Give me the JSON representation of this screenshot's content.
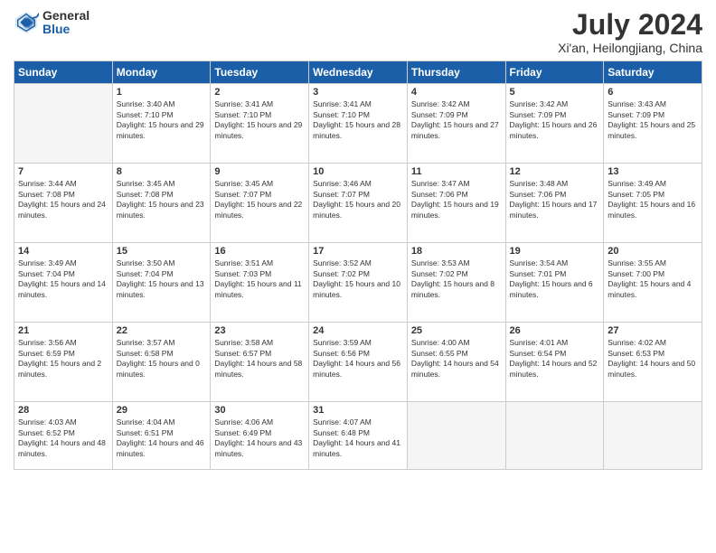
{
  "header": {
    "logo_general": "General",
    "logo_blue": "Blue",
    "month_year": "July 2024",
    "location": "Xi'an, Heilongjiang, China"
  },
  "days_of_week": [
    "Sunday",
    "Monday",
    "Tuesday",
    "Wednesday",
    "Thursday",
    "Friday",
    "Saturday"
  ],
  "weeks": [
    [
      {
        "day": "",
        "empty": true
      },
      {
        "day": "1",
        "sunrise": "3:40 AM",
        "sunset": "7:10 PM",
        "daylight": "15 hours and 29 minutes."
      },
      {
        "day": "2",
        "sunrise": "3:41 AM",
        "sunset": "7:10 PM",
        "daylight": "15 hours and 29 minutes."
      },
      {
        "day": "3",
        "sunrise": "3:41 AM",
        "sunset": "7:10 PM",
        "daylight": "15 hours and 28 minutes."
      },
      {
        "day": "4",
        "sunrise": "3:42 AM",
        "sunset": "7:09 PM",
        "daylight": "15 hours and 27 minutes."
      },
      {
        "day": "5",
        "sunrise": "3:42 AM",
        "sunset": "7:09 PM",
        "daylight": "15 hours and 26 minutes."
      },
      {
        "day": "6",
        "sunrise": "3:43 AM",
        "sunset": "7:09 PM",
        "daylight": "15 hours and 25 minutes."
      }
    ],
    [
      {
        "day": "7",
        "sunrise": "3:44 AM",
        "sunset": "7:08 PM",
        "daylight": "15 hours and 24 minutes."
      },
      {
        "day": "8",
        "sunrise": "3:45 AM",
        "sunset": "7:08 PM",
        "daylight": "15 hours and 23 minutes."
      },
      {
        "day": "9",
        "sunrise": "3:45 AM",
        "sunset": "7:07 PM",
        "daylight": "15 hours and 22 minutes."
      },
      {
        "day": "10",
        "sunrise": "3:46 AM",
        "sunset": "7:07 PM",
        "daylight": "15 hours and 20 minutes."
      },
      {
        "day": "11",
        "sunrise": "3:47 AM",
        "sunset": "7:06 PM",
        "daylight": "15 hours and 19 minutes."
      },
      {
        "day": "12",
        "sunrise": "3:48 AM",
        "sunset": "7:06 PM",
        "daylight": "15 hours and 17 minutes."
      },
      {
        "day": "13",
        "sunrise": "3:49 AM",
        "sunset": "7:05 PM",
        "daylight": "15 hours and 16 minutes."
      }
    ],
    [
      {
        "day": "14",
        "sunrise": "3:49 AM",
        "sunset": "7:04 PM",
        "daylight": "15 hours and 14 minutes."
      },
      {
        "day": "15",
        "sunrise": "3:50 AM",
        "sunset": "7:04 PM",
        "daylight": "15 hours and 13 minutes."
      },
      {
        "day": "16",
        "sunrise": "3:51 AM",
        "sunset": "7:03 PM",
        "daylight": "15 hours and 11 minutes."
      },
      {
        "day": "17",
        "sunrise": "3:52 AM",
        "sunset": "7:02 PM",
        "daylight": "15 hours and 10 minutes."
      },
      {
        "day": "18",
        "sunrise": "3:53 AM",
        "sunset": "7:02 PM",
        "daylight": "15 hours and 8 minutes."
      },
      {
        "day": "19",
        "sunrise": "3:54 AM",
        "sunset": "7:01 PM",
        "daylight": "15 hours and 6 minutes."
      },
      {
        "day": "20",
        "sunrise": "3:55 AM",
        "sunset": "7:00 PM",
        "daylight": "15 hours and 4 minutes."
      }
    ],
    [
      {
        "day": "21",
        "sunrise": "3:56 AM",
        "sunset": "6:59 PM",
        "daylight": "15 hours and 2 minutes."
      },
      {
        "day": "22",
        "sunrise": "3:57 AM",
        "sunset": "6:58 PM",
        "daylight": "15 hours and 0 minutes."
      },
      {
        "day": "23",
        "sunrise": "3:58 AM",
        "sunset": "6:57 PM",
        "daylight": "14 hours and 58 minutes."
      },
      {
        "day": "24",
        "sunrise": "3:59 AM",
        "sunset": "6:56 PM",
        "daylight": "14 hours and 56 minutes."
      },
      {
        "day": "25",
        "sunrise": "4:00 AM",
        "sunset": "6:55 PM",
        "daylight": "14 hours and 54 minutes."
      },
      {
        "day": "26",
        "sunrise": "4:01 AM",
        "sunset": "6:54 PM",
        "daylight": "14 hours and 52 minutes."
      },
      {
        "day": "27",
        "sunrise": "4:02 AM",
        "sunset": "6:53 PM",
        "daylight": "14 hours and 50 minutes."
      }
    ],
    [
      {
        "day": "28",
        "sunrise": "4:03 AM",
        "sunset": "6:52 PM",
        "daylight": "14 hours and 48 minutes."
      },
      {
        "day": "29",
        "sunrise": "4:04 AM",
        "sunset": "6:51 PM",
        "daylight": "14 hours and 46 minutes."
      },
      {
        "day": "30",
        "sunrise": "4:06 AM",
        "sunset": "6:49 PM",
        "daylight": "14 hours and 43 minutes."
      },
      {
        "day": "31",
        "sunrise": "4:07 AM",
        "sunset": "6:48 PM",
        "daylight": "14 hours and 41 minutes."
      },
      {
        "day": "",
        "empty": true
      },
      {
        "day": "",
        "empty": true
      },
      {
        "day": "",
        "empty": true
      }
    ]
  ]
}
